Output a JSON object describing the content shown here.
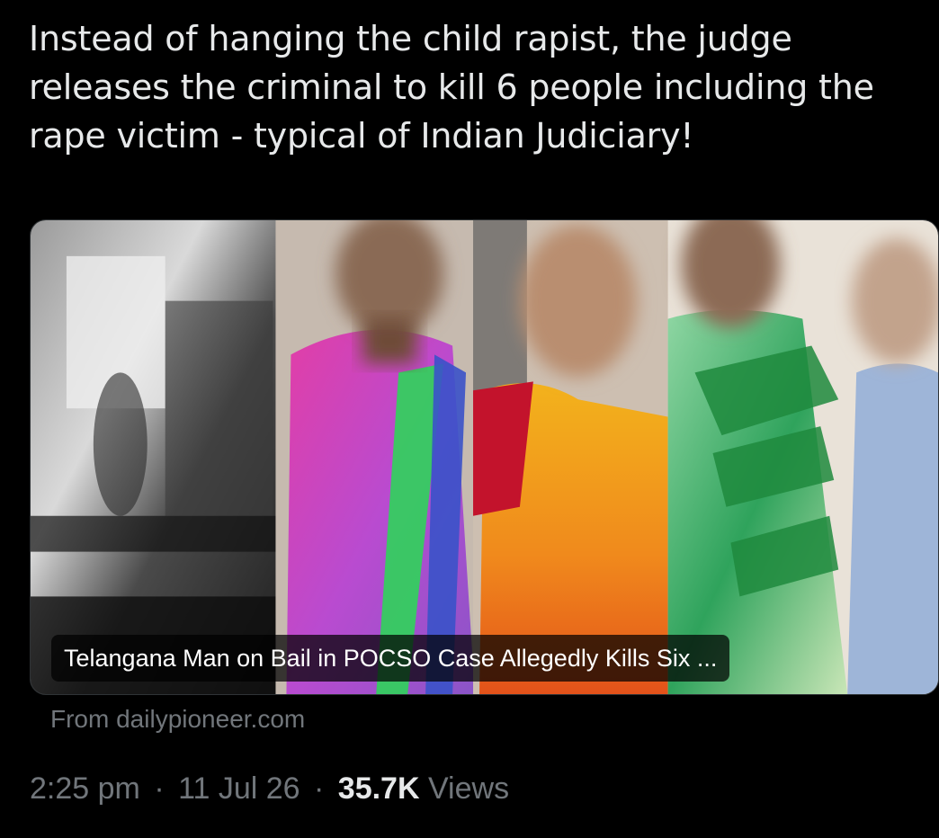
{
  "tweet": {
    "text": "Instead of hanging the child rapist, the judge releases the criminal to kill 6 people including the rape victim - typical of Indian Judiciary!"
  },
  "link_card": {
    "title": "Telangana Man on Bail in POCSO Case Allegedly Kills Six ...",
    "source": "From dailypioneer.com"
  },
  "meta": {
    "time": "2:25 pm",
    "separator": "·",
    "date": "11 Jul 26",
    "views_count": "35.7K",
    "views_label": "Views"
  },
  "colors": {
    "background": "#000000",
    "primary_text": "#e7e9ea",
    "secondary_text": "#71767b"
  }
}
